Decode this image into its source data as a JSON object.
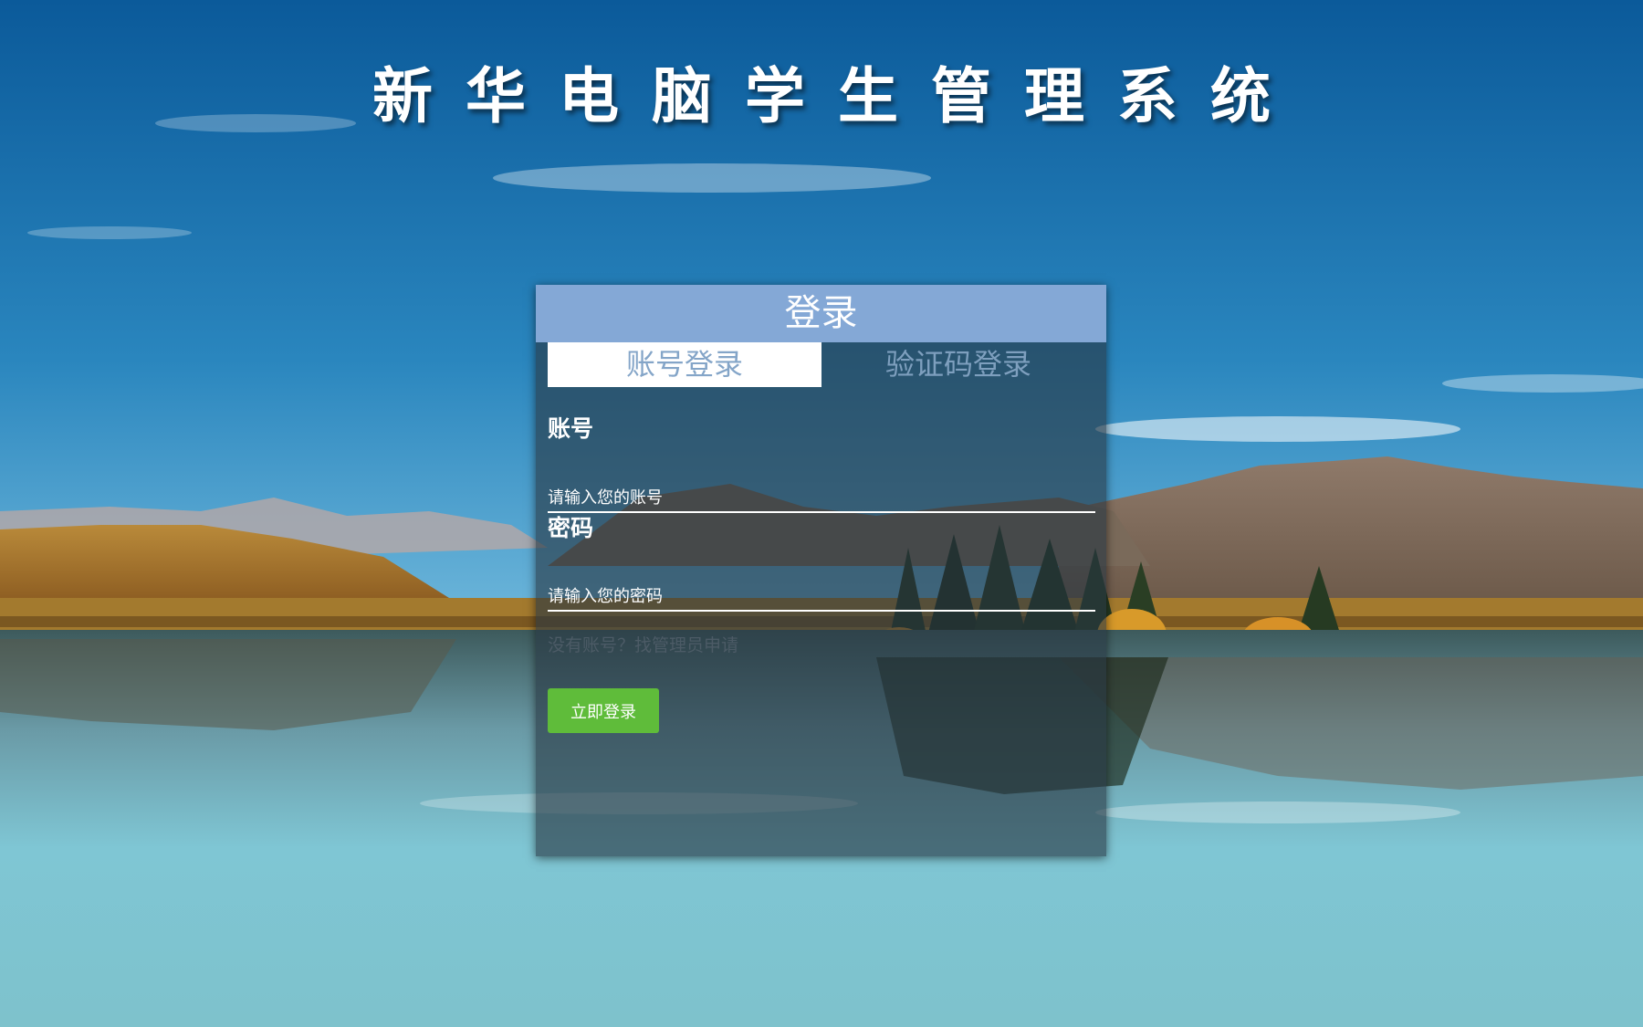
{
  "app_title": "新华电脑学生管理系统",
  "login": {
    "header": "登录",
    "tabs": [
      {
        "label": "账号登录",
        "active": true
      },
      {
        "label": "验证码登录",
        "active": false
      }
    ],
    "account_label": "账号",
    "account_placeholder": "请输入您的账号",
    "account_value": "",
    "password_label": "密码",
    "password_placeholder": "请输入您的密码",
    "password_value": "",
    "apply_link": "没有账号？找管理员申请",
    "submit_label": "立即登录"
  },
  "colors": {
    "header_bg": "#84a8d6",
    "submit_bg": "#5fbc3a",
    "panel_bg": "rgba(38,54,64,0.62)",
    "sky_top": "#0f5fa0",
    "lake": "#7fc6d4"
  },
  "background": {
    "scene": "mountain-lake-landscape"
  }
}
